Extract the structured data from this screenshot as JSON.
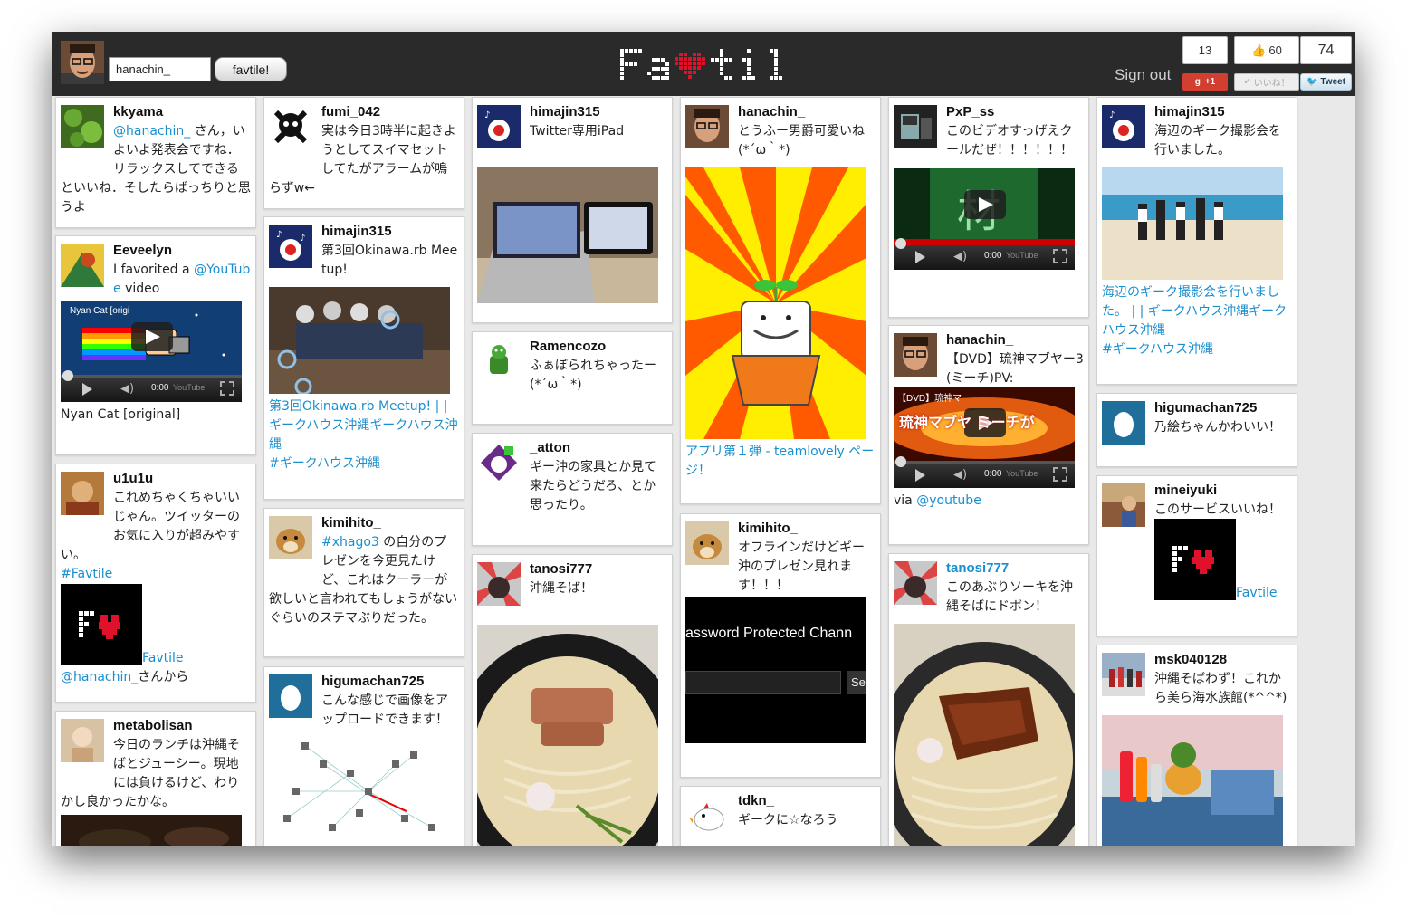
{
  "topbar": {
    "username_value": "hanachin_",
    "favtile_button": "favtile!",
    "sign_out": "Sign out",
    "gplus_count": "13",
    "gplus_label": "+1",
    "like_count": "60",
    "like_label": "いいね！",
    "tweet_count": "74",
    "tweet_label": "Tweet"
  },
  "cards": {
    "c1": {
      "user": "kkyama",
      "mention": "@hanachin_",
      "text": " さん，いよいよ発表会ですね．リラックスしてできるといいね．そしたらばっちりと思うよ"
    },
    "c2": {
      "user": "Eeveelyn",
      "text1": "I favorited a ",
      "mention": "@YouTube",
      "text2": " video",
      "video_title": "Nyan Cat [origi",
      "caption": "Nyan Cat [original]",
      "time": "0:00"
    },
    "c3": {
      "user": "u1u1u",
      "text": "これめちゃくちゃいいじゃん。ツイッターのお気に入りが超みやすい。",
      "hashtag": "#Favtile",
      "link": "Favtile",
      "mention": "@hanachin_",
      "suffix": "さんから"
    },
    "c4": {
      "user": "metabolisan",
      "text": "今日のランチは沖縄そばとジューシー。現地には負けるけど、わりかし良かったかな。"
    },
    "c5": {
      "user": "fumi_042",
      "text": "実は今日3時半に起きようとしてスイマセットしてたがアラームが鳴らずw←"
    },
    "c6": {
      "user": "himajin315",
      "text": "第3回Okinawa.rb Meetup!",
      "link": "第3回Okinawa.rb Meetup! | | ギークハウス沖縄ギークハウス沖縄",
      "hashtag": "#ギークハウス沖縄"
    },
    "c7": {
      "user": "kimihito_",
      "hashtag": "#xhago3",
      "text": " の自分のプレゼンを今更見たけど、これはクーラーが欲しいと言われてもしょうがないぐらいのステマぶりだった。"
    },
    "c8": {
      "user": "higumachan725",
      "text": "こんな感じで画像をアップロードできます！"
    },
    "c9": {
      "user": "himajin315",
      "text": "Twitter専用iPad"
    },
    "c10": {
      "user": "Ramencozo",
      "text": "ふぁぼられちゃったー(*´ω｀*)"
    },
    "c11": {
      "user": "_atton",
      "text": "ギー沖の家具とか見て来たらどうだろ、とか思ったり。"
    },
    "c12": {
      "user": "tanosi777",
      "text": "沖縄そば！"
    },
    "c13": {
      "user": "hanachin_",
      "text": "とうふー男爵可愛いね(*´ω｀*)",
      "link": "アプリ第１弾 - teamlovely ページ！"
    },
    "c14": {
      "user": "kimihito_",
      "text": "オフラインだけどギー沖のプレゼン見れます！！！",
      "video_text": "assword Protected Chann",
      "button": "Se"
    },
    "c15": {
      "user": "tdkn_",
      "text": "ギークに☆なろう"
    },
    "c16": {
      "user": "PxP_ss",
      "text": "このビデオすっげえクールだぜ！！！！！！",
      "time": "0:00"
    },
    "c17": {
      "user": "hanachin_",
      "text": "【DVD】琉神マブヤー3(ミーチ)PV:",
      "video_title": "【DVD】琉神マ",
      "video_overlay": "琉神マブヤ ミーチが",
      "via": "via ",
      "mention": "@youtube",
      "time": "0:00"
    },
    "c18": {
      "user": "tanosi777",
      "text": "このあぶりソーキを沖縄そばにドボン！"
    },
    "c19": {
      "user": "himajin315",
      "text": "海辺のギーク撮影会を行いました。",
      "link": "海辺のギーク撮影会を行いました。 | | ギークハウス沖縄ギークハウス沖縄",
      "hashtag": "#ギークハウス沖縄"
    },
    "c20": {
      "user": "higumachan725",
      "text": "乃絵ちゃんかわいい！"
    },
    "c21": {
      "user": "mineiyuki",
      "text": "このサービスいいね！",
      "link": "Favtile"
    },
    "c22": {
      "user": "msk040128",
      "text": "沖縄そばわず！これから美ら海水族館(*^^*)"
    }
  },
  "youtube_logo": "YouTube",
  "colors": {
    "topbar": "#2a2a2a",
    "link": "#1a8fcf",
    "background": "#e9e9e9",
    "heart": "#e0112b",
    "gplus": "#d23f31"
  }
}
